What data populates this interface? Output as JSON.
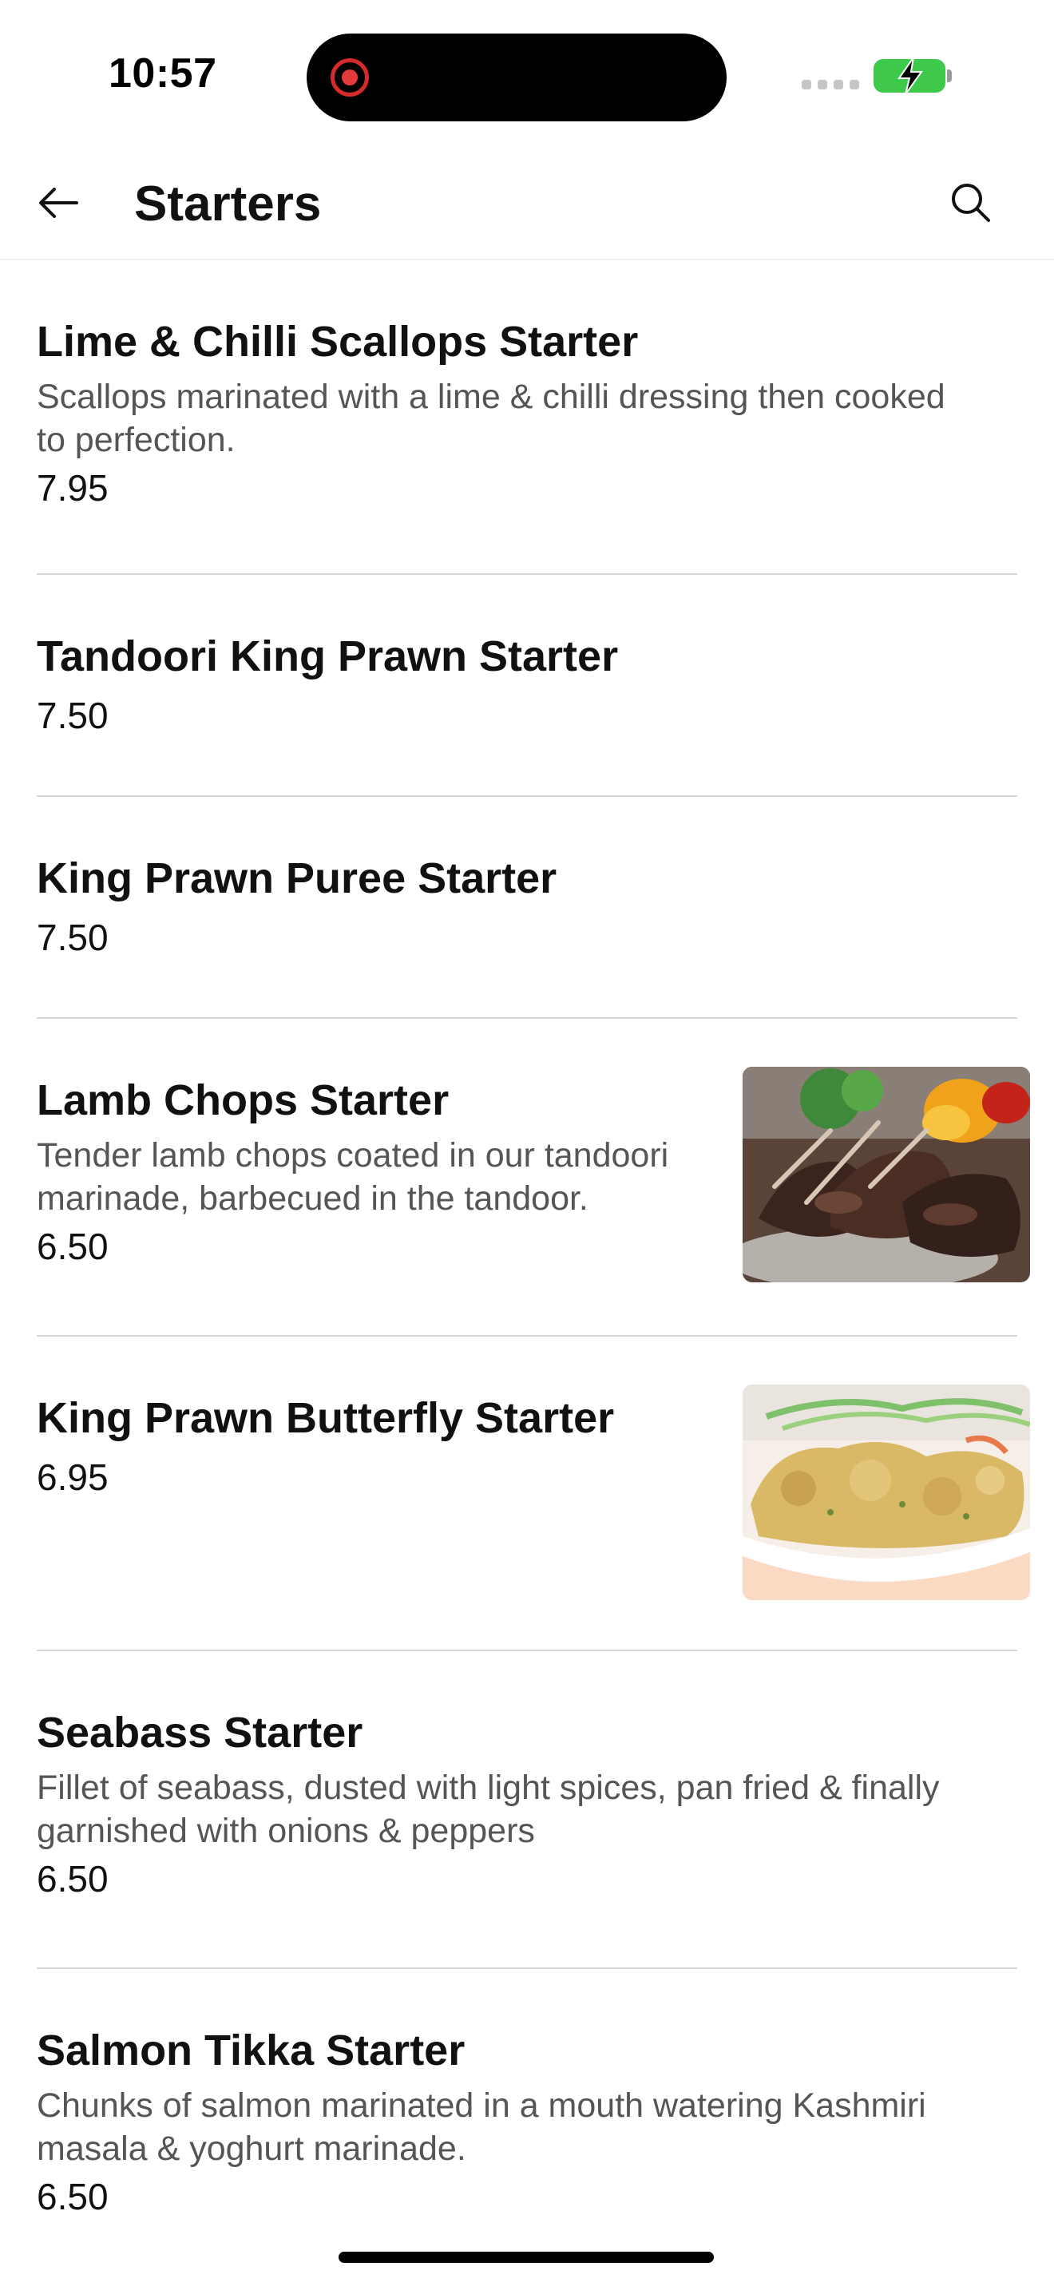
{
  "status_bar": {
    "time": "10:57",
    "icons": [
      "screen-record-icon",
      "signal-icon",
      "battery-charging-icon"
    ]
  },
  "header": {
    "title": "Starters",
    "back_icon": "arrow-left-icon",
    "search_icon": "search-icon"
  },
  "items": [
    {
      "name": "Lime & Chilli Scallops Starter",
      "description": "Scallops marinated with a lime & chilli dressing then cooked to perfection.",
      "price": "7.95"
    },
    {
      "name": "Tandoori King Prawn Starter",
      "description": "",
      "price": "7.50"
    },
    {
      "name": "King Prawn Puree Starter",
      "description": "",
      "price": "7.50"
    },
    {
      "name": "Lamb Chops Starter",
      "description": "Tender lamb chops coated in our tandoori marinade, barbecued in the tandoor.",
      "price": "6.50",
      "image": "lamb-chops-photo"
    },
    {
      "name": "King Prawn Butterfly Starter",
      "description": "",
      "price": "6.95",
      "image": "king-prawn-butterfly-photo"
    },
    {
      "name": "Seabass Starter",
      "description": "Fillet of seabass, dusted with light spices, pan fried & finally garnished with onions & peppers",
      "price": "6.50"
    },
    {
      "name": "Salmon Tikka Starter",
      "description": "Chunks of salmon marinated in a mouth watering Kashmiri masala & yoghurt marinade.",
      "price": "6.50"
    }
  ],
  "colors": {
    "text_primary": "#111111",
    "text_secondary": "#555555",
    "divider": "#d6d6d6",
    "battery": "#3fc94b",
    "record": "#e33a3a"
  }
}
